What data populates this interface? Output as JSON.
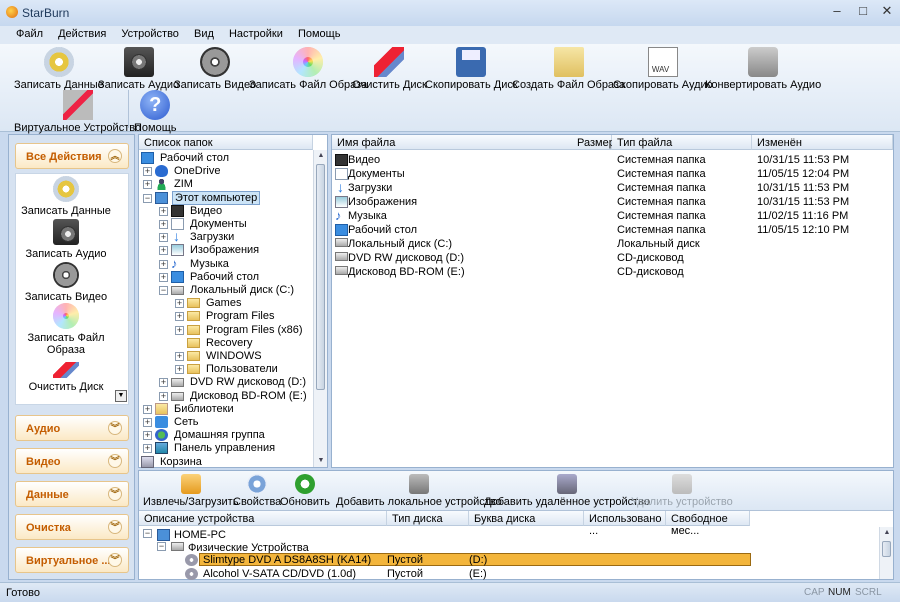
{
  "window": {
    "title": "StarBurn",
    "min": "–",
    "max": "□",
    "close": "✕"
  },
  "menu": [
    "Файл",
    "Действия",
    "Устройство",
    "Вид",
    "Настройки",
    "Помощь"
  ],
  "toolbar": [
    {
      "label": "Записать Данные",
      "icon": "cd-icon"
    },
    {
      "label": "Записать Аудио",
      "icon": "speaker-icon"
    },
    {
      "label": "Записать Видео",
      "icon": "film-reel-icon"
    },
    {
      "label": "Записать Файл Образа",
      "icon": "iso-disc-icon"
    },
    {
      "label": "Очистить Диск",
      "icon": "eraser-icon"
    },
    {
      "label": "Скопировать Диск",
      "icon": "floppy-icon"
    },
    {
      "label": "Создать Файл Образа",
      "icon": "folder-icon"
    },
    {
      "label": "Скопировать Аудио",
      "icon": "wav-file-icon"
    },
    {
      "label": "Конвертировать Аудио",
      "icon": "convert-icon"
    }
  ],
  "toolbar2": [
    {
      "label": "Виртуальное Устройство",
      "icon": "virtual-device-icon"
    },
    {
      "label": "Помощь",
      "icon": "help-icon",
      "glyph": "?"
    }
  ],
  "actions": {
    "all": "Все Действия",
    "chev_up": "︽",
    "chev_down": "︾",
    "items": [
      {
        "label": "Записать Данные"
      },
      {
        "label": "Записать Аудио"
      },
      {
        "label": "Записать Видео"
      },
      {
        "label": "Записать Файл Образа"
      },
      {
        "label": "Очистить Диск"
      }
    ],
    "scroll_glyph": "▼",
    "groups": [
      "Аудио",
      "Видео",
      "Данные",
      "Очистка",
      "Виртуальное ..."
    ]
  },
  "tree": {
    "header": "Список папок",
    "rows": [
      {
        "label": "Рабочий стол",
        "exp": "",
        "icon": "desk"
      },
      {
        "label": "OneDrive",
        "exp": "+",
        "icon": "cloud"
      },
      {
        "label": "ZIM",
        "exp": "+",
        "icon": "user"
      },
      {
        "label": "Этот компьютер",
        "exp": "−",
        "icon": "pc",
        "selected": true
      },
      {
        "label": "Видео",
        "exp": "+",
        "icon": "vid"
      },
      {
        "label": "Документы",
        "exp": "+",
        "icon": "doc"
      },
      {
        "label": "Загрузки",
        "exp": "+",
        "icon": "down"
      },
      {
        "label": "Изображения",
        "exp": "+",
        "icon": "img"
      },
      {
        "label": "Музыка",
        "exp": "+",
        "icon": "music",
        "glyph": "♪"
      },
      {
        "label": "Рабочий стол",
        "exp": "+",
        "icon": "desk"
      },
      {
        "label": "Локальный диск (C:)",
        "exp": "−",
        "icon": "drive"
      },
      {
        "label": "Games",
        "exp": "+",
        "icon": "folder"
      },
      {
        "label": "Program Files",
        "exp": "+",
        "icon": "folder"
      },
      {
        "label": "Program Files (x86)",
        "exp": "+",
        "icon": "folder"
      },
      {
        "label": "Recovery",
        "exp": "",
        "icon": "folder"
      },
      {
        "label": "WINDOWS",
        "exp": "+",
        "icon": "folder"
      },
      {
        "label": "Пользователи",
        "exp": "+",
        "icon": "folder"
      },
      {
        "label": "DVD RW дисковод (D:)",
        "exp": "+",
        "icon": "drive"
      },
      {
        "label": "Дисковод BD-ROM (E:)",
        "exp": "+",
        "icon": "drive"
      },
      {
        "label": "Библиотеки",
        "exp": "+",
        "icon": "lib"
      },
      {
        "label": "Сеть",
        "exp": "+",
        "icon": "net"
      },
      {
        "label": "Домашняя группа",
        "exp": "+",
        "icon": "group"
      },
      {
        "label": "Панель управления",
        "exp": "+",
        "icon": "cp"
      },
      {
        "label": "Корзина",
        "exp": "",
        "icon": "bin"
      }
    ]
  },
  "files": {
    "columns": [
      "Имя файла",
      "Размер",
      "Тип файла",
      "Изменён"
    ],
    "rows": [
      {
        "name": "Видео",
        "size": "",
        "type": "Системная папка",
        "date": "10/31/15 11:53 PM",
        "icon": "vid"
      },
      {
        "name": "Документы",
        "size": "",
        "type": "Системная папка",
        "date": "11/05/15 12:04 PM",
        "icon": "doc"
      },
      {
        "name": "Загрузки",
        "size": "",
        "type": "Системная папка",
        "date": "10/31/15 11:53 PM",
        "icon": "down"
      },
      {
        "name": "Изображения",
        "size": "",
        "type": "Системная папка",
        "date": "10/31/15 11:53 PM",
        "icon": "img"
      },
      {
        "name": "Музыка",
        "size": "",
        "type": "Системная папка",
        "date": "11/02/15 11:16 PM",
        "icon": "music",
        "glyph": "♪"
      },
      {
        "name": "Рабочий стол",
        "size": "",
        "type": "Системная папка",
        "date": "11/05/15 12:10 PM",
        "icon": "desk"
      },
      {
        "name": "Локальный диск (C:)",
        "size": "",
        "type": "Локальный диск",
        "date": "",
        "icon": "drive"
      },
      {
        "name": "DVD RW дисковод (D:)",
        "size": "",
        "type": "CD-дисковод",
        "date": "",
        "icon": "drive"
      },
      {
        "name": "Дисковод BD-ROM (E:)",
        "size": "",
        "type": "CD-дисковод",
        "date": "",
        "icon": "drive"
      }
    ]
  },
  "device_toolbar": [
    {
      "label": "Извлечь/Загрузить",
      "icon": "eject-icon",
      "enabled": true
    },
    {
      "label": "Свойства",
      "icon": "gear-icon",
      "enabled": true
    },
    {
      "label": "Обновить",
      "icon": "refresh-icon",
      "enabled": true
    },
    {
      "label": "Добавить локальное устройство",
      "icon": "add-local-device-icon",
      "enabled": true
    },
    {
      "label": "Добавить удалённое устройство",
      "icon": "add-remote-device-icon",
      "enabled": true
    },
    {
      "label": "Удалить устройство",
      "icon": "remove-device-icon",
      "enabled": false
    }
  ],
  "devices": {
    "columns": [
      "Описание устройства",
      "Тип диска",
      "Буква диска",
      "Использовано ...",
      "Свободное мес..."
    ],
    "root": {
      "label": "HOME-PC",
      "exp": "−"
    },
    "group": {
      "label": "Физические Устройства",
      "exp": "−"
    },
    "rows": [
      {
        "name": "Slimtype DVD A  DS8A8SH   (KA14)",
        "type": "Пустой",
        "letter": "(D:)",
        "selected": true
      },
      {
        "name": "Alcohol  V-SATA CD/DVD   (1.0d)",
        "type": "Пустой",
        "letter": "(E:)",
        "selected": false
      }
    ]
  },
  "status": {
    "text": "Готово",
    "cap": "CAP",
    "num": "NUM",
    "scrl": "SCRL"
  },
  "colors": {
    "accent": "#c45d00",
    "selection": "#f3b53b",
    "tree_selection": "#cce4f7"
  }
}
